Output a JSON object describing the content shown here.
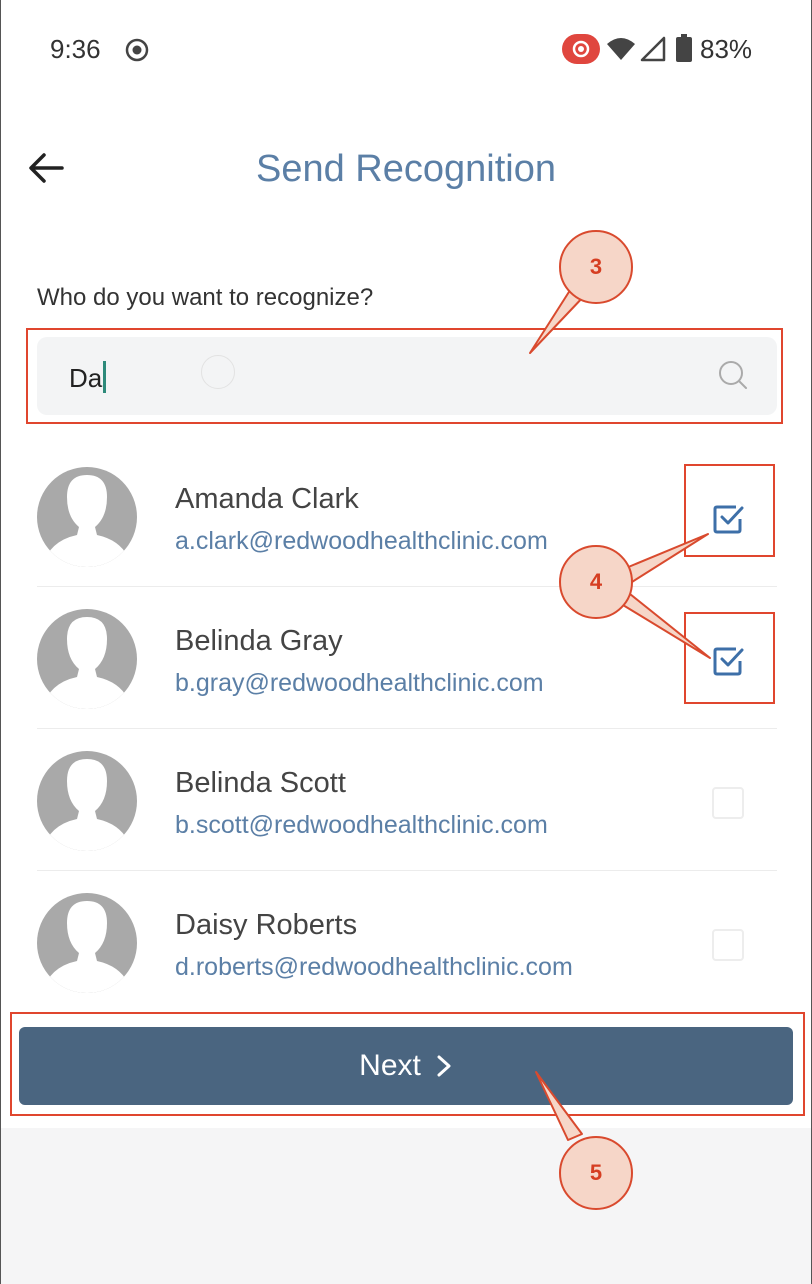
{
  "status_bar": {
    "time": "9:36",
    "battery": "83%",
    "icons": [
      "record-icon",
      "cast-icon",
      "wifi-icon",
      "signal-icon",
      "battery-icon"
    ]
  },
  "header": {
    "title": "Send Recognition",
    "back_icon": "arrow-left-icon"
  },
  "search": {
    "question": "Who do you want to recognize?",
    "value": "Da",
    "icon": "search-icon"
  },
  "people": [
    {
      "name": "Amanda Clark",
      "email": "a.clark@redwoodhealthclinic.com",
      "checked": true
    },
    {
      "name": "Belinda Gray",
      "email": "b.gray@redwoodhealthclinic.com",
      "checked": true
    },
    {
      "name": "Belinda Scott",
      "email": "b.scott@redwoodhealthclinic.com",
      "checked": false
    },
    {
      "name": "Daisy Roberts",
      "email": "d.roberts@redwoodhealthclinic.com",
      "checked": false
    }
  ],
  "next_button": {
    "label": "Next"
  },
  "annotations": {
    "callout_3": "3",
    "callout_4": "4",
    "callout_5": "5"
  },
  "colors": {
    "title": "#5b7fa6",
    "email": "#5b7fa6",
    "button": "#4a6580",
    "check": "#3d6fa8",
    "annotation": "#e0462e"
  }
}
